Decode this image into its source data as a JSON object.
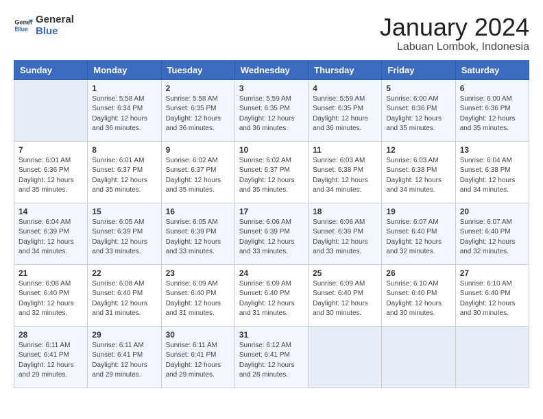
{
  "logo": {
    "line1": "General",
    "line2": "Blue"
  },
  "header": {
    "month_year": "January 2024",
    "location": "Labuan Lombok, Indonesia"
  },
  "days_of_week": [
    "Sunday",
    "Monday",
    "Tuesday",
    "Wednesday",
    "Thursday",
    "Friday",
    "Saturday"
  ],
  "weeks": [
    [
      {
        "day": "",
        "info": ""
      },
      {
        "day": "1",
        "info": "Sunrise: 5:58 AM\nSunset: 6:34 PM\nDaylight: 12 hours\nand 36 minutes."
      },
      {
        "day": "2",
        "info": "Sunrise: 5:58 AM\nSunset: 6:35 PM\nDaylight: 12 hours\nand 36 minutes."
      },
      {
        "day": "3",
        "info": "Sunrise: 5:59 AM\nSunset: 6:35 PM\nDaylight: 12 hours\nand 36 minutes."
      },
      {
        "day": "4",
        "info": "Sunrise: 5:59 AM\nSunset: 6:35 PM\nDaylight: 12 hours\nand 36 minutes."
      },
      {
        "day": "5",
        "info": "Sunrise: 6:00 AM\nSunset: 6:36 PM\nDaylight: 12 hours\nand 35 minutes."
      },
      {
        "day": "6",
        "info": "Sunrise: 6:00 AM\nSunset: 6:36 PM\nDaylight: 12 hours\nand 35 minutes."
      }
    ],
    [
      {
        "day": "7",
        "info": "Sunrise: 6:01 AM\nSunset: 6:36 PM\nDaylight: 12 hours\nand 35 minutes."
      },
      {
        "day": "8",
        "info": "Sunrise: 6:01 AM\nSunset: 6:37 PM\nDaylight: 12 hours\nand 35 minutes."
      },
      {
        "day": "9",
        "info": "Sunrise: 6:02 AM\nSunset: 6:37 PM\nDaylight: 12 hours\nand 35 minutes."
      },
      {
        "day": "10",
        "info": "Sunrise: 6:02 AM\nSunset: 6:37 PM\nDaylight: 12 hours\nand 35 minutes."
      },
      {
        "day": "11",
        "info": "Sunrise: 6:03 AM\nSunset: 6:38 PM\nDaylight: 12 hours\nand 34 minutes."
      },
      {
        "day": "12",
        "info": "Sunrise: 6:03 AM\nSunset: 6:38 PM\nDaylight: 12 hours\nand 34 minutes."
      },
      {
        "day": "13",
        "info": "Sunrise: 6:04 AM\nSunset: 6:38 PM\nDaylight: 12 hours\nand 34 minutes."
      }
    ],
    [
      {
        "day": "14",
        "info": "Sunrise: 6:04 AM\nSunset: 6:39 PM\nDaylight: 12 hours\nand 34 minutes."
      },
      {
        "day": "15",
        "info": "Sunrise: 6:05 AM\nSunset: 6:39 PM\nDaylight: 12 hours\nand 33 minutes."
      },
      {
        "day": "16",
        "info": "Sunrise: 6:05 AM\nSunset: 6:39 PM\nDaylight: 12 hours\nand 33 minutes."
      },
      {
        "day": "17",
        "info": "Sunrise: 6:06 AM\nSunset: 6:39 PM\nDaylight: 12 hours\nand 33 minutes."
      },
      {
        "day": "18",
        "info": "Sunrise: 6:06 AM\nSunset: 6:39 PM\nDaylight: 12 hours\nand 33 minutes."
      },
      {
        "day": "19",
        "info": "Sunrise: 6:07 AM\nSunset: 6:40 PM\nDaylight: 12 hours\nand 32 minutes."
      },
      {
        "day": "20",
        "info": "Sunrise: 6:07 AM\nSunset: 6:40 PM\nDaylight: 12 hours\nand 32 minutes."
      }
    ],
    [
      {
        "day": "21",
        "info": "Sunrise: 6:08 AM\nSunset: 6:40 PM\nDaylight: 12 hours\nand 32 minutes."
      },
      {
        "day": "22",
        "info": "Sunrise: 6:08 AM\nSunset: 6:40 PM\nDaylight: 12 hours\nand 31 minutes."
      },
      {
        "day": "23",
        "info": "Sunrise: 6:09 AM\nSunset: 6:40 PM\nDaylight: 12 hours\nand 31 minutes."
      },
      {
        "day": "24",
        "info": "Sunrise: 6:09 AM\nSunset: 6:40 PM\nDaylight: 12 hours\nand 31 minutes."
      },
      {
        "day": "25",
        "info": "Sunrise: 6:09 AM\nSunset: 6:40 PM\nDaylight: 12 hours\nand 30 minutes."
      },
      {
        "day": "26",
        "info": "Sunrise: 6:10 AM\nSunset: 6:40 PM\nDaylight: 12 hours\nand 30 minutes."
      },
      {
        "day": "27",
        "info": "Sunrise: 6:10 AM\nSunset: 6:40 PM\nDaylight: 12 hours\nand 30 minutes."
      }
    ],
    [
      {
        "day": "28",
        "info": "Sunrise: 6:11 AM\nSunset: 6:41 PM\nDaylight: 12 hours\nand 29 minutes."
      },
      {
        "day": "29",
        "info": "Sunrise: 6:11 AM\nSunset: 6:41 PM\nDaylight: 12 hours\nand 29 minutes."
      },
      {
        "day": "30",
        "info": "Sunrise: 6:11 AM\nSunset: 6:41 PM\nDaylight: 12 hours\nand 29 minutes."
      },
      {
        "day": "31",
        "info": "Sunrise: 6:12 AM\nSunset: 6:41 PM\nDaylight: 12 hours\nand 28 minutes."
      },
      {
        "day": "",
        "info": ""
      },
      {
        "day": "",
        "info": ""
      },
      {
        "day": "",
        "info": ""
      }
    ]
  ]
}
